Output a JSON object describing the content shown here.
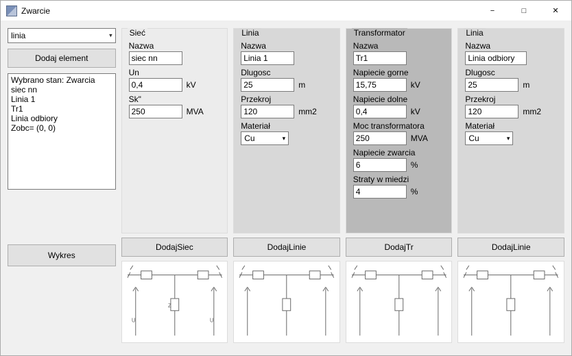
{
  "window": {
    "title": "Zwarcie"
  },
  "left": {
    "combo_value": "linia",
    "add_element": "Dodaj element",
    "listbox": "Wybrano stan: Zwarcia\nsiec nn\nLinia 1\nTr1\nLinia odbiory\nZobc= (0, 0)",
    "wykres": "Wykres"
  },
  "panels": {
    "siec": {
      "title": "Sieć",
      "nazwa_label": "Nazwa",
      "nazwa": "siec nn",
      "un_label": "Un",
      "un": "0,4",
      "un_unit": "kV",
      "sk_label": "Sk\"",
      "sk": "250",
      "sk_unit": "MVA",
      "btn": "DodajSiec"
    },
    "linia1": {
      "title": "Linia",
      "nazwa_label": "Nazwa",
      "nazwa": "Linia 1",
      "dlugosc_label": "Dlugosc",
      "dlugosc": "25",
      "dlugosc_unit": "m",
      "przekroj_label": "Przekroj",
      "przekroj": "120",
      "przekroj_unit": "mm2",
      "material_label": "Materiał",
      "material": "Cu",
      "btn": "DodajLinie"
    },
    "tr": {
      "title": "Transformator",
      "nazwa_label": "Nazwa",
      "nazwa": "Tr1",
      "ng_label": "Napiecie gorne",
      "ng": "15,75",
      "ng_unit": "kV",
      "nd_label": "Napiecie dolne",
      "nd": "0,4",
      "nd_unit": "kV",
      "moc_label": "Moc transformatora",
      "moc": "250",
      "moc_unit": "MVA",
      "nz_label": "Napiecie zwarcia",
      "nz": "6",
      "nz_unit": "%",
      "sw_label": "Straty w miedzi",
      "sw": "4",
      "sw_unit": "%",
      "btn": "DodajTr"
    },
    "linia2": {
      "title": "Linia",
      "nazwa_label": "Nazwa",
      "nazwa": "Linia odbiory",
      "dlugosc_label": "Dlugosc",
      "dlugosc": "25",
      "dlugosc_unit": "m",
      "przekroj_label": "Przekroj",
      "przekroj": "120",
      "przekroj_unit": "mm2",
      "material_label": "Materiał",
      "material": "Cu",
      "btn": "DodajLinie"
    }
  }
}
